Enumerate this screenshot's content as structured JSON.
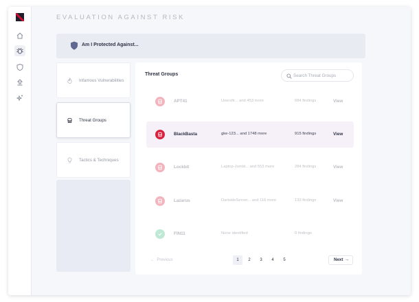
{
  "page": {
    "title": "EVALUATION AGAINST RISK"
  },
  "nav": {
    "items": [
      {
        "icon": "home-icon"
      },
      {
        "icon": "bug-icon",
        "active": true
      },
      {
        "icon": "shield-icon"
      },
      {
        "icon": "upload-icon"
      },
      {
        "icon": "sparkles-icon"
      }
    ]
  },
  "banner": {
    "text": "Am I Protected Against...",
    "icon": "shield-icon"
  },
  "categories": [
    {
      "label": "Infamous Vulnerabilities",
      "icon": "flame-icon"
    },
    {
      "label": "Threat Groups",
      "icon": "threat-group-icon",
      "active": true
    },
    {
      "label": "Tactics & Techniques",
      "icon": "lightbulb-icon"
    }
  ],
  "threat_groups": {
    "title": "Threat Groups",
    "search_placeholder": "Search Threat Groups",
    "rows": [
      {
        "name": "APT41",
        "hosts": "Usersfir... and 453 more",
        "findings": "684 findings",
        "view": "View",
        "status": "critical"
      },
      {
        "name": "BlackBasta",
        "hosts": "gke-123... and 1748 more",
        "findings": "915 findings",
        "view": "View",
        "status": "critical"
      },
      {
        "name": "Lockbit",
        "hosts": "Laptop-Jumbl... and 553 more",
        "findings": "284 findings",
        "view": "View",
        "status": "critical"
      },
      {
        "name": "Lazarus",
        "hosts": "DartsideServer... and 116 more",
        "findings": "132 findings",
        "view": "View",
        "status": "critical"
      },
      {
        "name": "FIN11",
        "hosts": "None identified",
        "findings": "0 findings",
        "view": "",
        "status": "safe"
      }
    ],
    "pagination": {
      "previous": "Previous",
      "pages": [
        "1",
        "2",
        "3",
        "4",
        "5"
      ],
      "current": "1",
      "next": "Next"
    }
  },
  "colors": {
    "critical": "#d9223f",
    "safe": "#3fbf7f",
    "accent": "#2e3244"
  }
}
